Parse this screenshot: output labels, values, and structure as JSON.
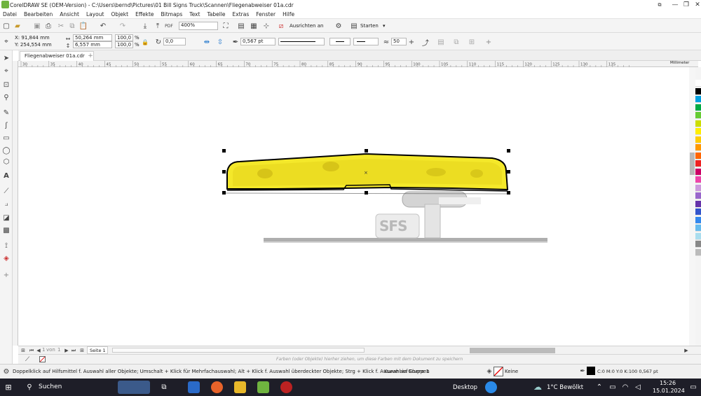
{
  "window": {
    "title": "CorelDRAW SE (OEM-Version) - C:\\Users\\bernd\\Pictures\\01 Bill Signs Truck\\Scannen\\Fliegenabweiser 01a.cdr",
    "min": "—",
    "max": "❐",
    "close": "✕"
  },
  "menu": [
    "Datei",
    "Bearbeiten",
    "Ansicht",
    "Layout",
    "Objekt",
    "Effekte",
    "Bitmaps",
    "Text",
    "Tabelle",
    "Extras",
    "Fenster",
    "Hilfe"
  ],
  "toolbar": {
    "zoom": "400%",
    "align_label": "Ausrichten an",
    "launch_label": "Starten",
    "pdf_label": "PDF"
  },
  "properties": {
    "x": "X: 91,844 mm",
    "y": "Y: 254,554 mm",
    "w": "50,264 mm",
    "h": "6,557 mm",
    "scale_x": "100,0",
    "scale_y": "100,0",
    "pct": "%",
    "angle": "0,0",
    "outline_width": "0,567 pt",
    "smoothing": "50"
  },
  "document_tab": "Fliegenabweiser 01a.cdr",
  "ruler": {
    "ticks": [
      "30",
      "35",
      "40",
      "45",
      "50",
      "55",
      "60",
      "65",
      "70",
      "75",
      "80",
      "85",
      "90",
      "95",
      "100",
      "105",
      "110",
      "115",
      "120",
      "125",
      "130",
      "135"
    ],
    "unit": "Millimeter"
  },
  "pagenav": {
    "page": "1",
    "of_label": "von",
    "total": "1",
    "tab": "Seite 1"
  },
  "colorbar_hint": "Farben (oder Objekte) hierher ziehen, um diese Farben mit dem Dokument zu speichern",
  "status": {
    "hint": "Doppelklick auf Hilfsmittel f. Auswahl aller Objekte; Umschalt + Klick für Mehrfachauswahl; Alt + Klick f. Auswahl überdeckter Objekte; Strg + Klick f. Auswahl in Gruppen",
    "layer": "Kurve auf Ebene 1",
    "fill": "Keine",
    "outline": "C:0 M:0 Y:0 K:100  0,567 pt"
  },
  "taskbar": {
    "search": "Suchen",
    "desktop": "Desktop",
    "weather": "1°C  Bewölkt",
    "time": "15:26",
    "date": "15.01.2024"
  },
  "palette_colors": [
    "#ffffff",
    "#000000",
    "#00a0e0",
    "#00aa44",
    "#66cc33",
    "#ccdd00",
    "#ffee00",
    "#ffcc00",
    "#ff9900",
    "#ff6600",
    "#ee2222",
    "#cc0066",
    "#ee44aa",
    "#cc99dd",
    "#9966cc",
    "#6633aa",
    "#3355cc",
    "#3388ee",
    "#66bbee",
    "#aaddee",
    "#888888",
    "#bbbbbb"
  ]
}
